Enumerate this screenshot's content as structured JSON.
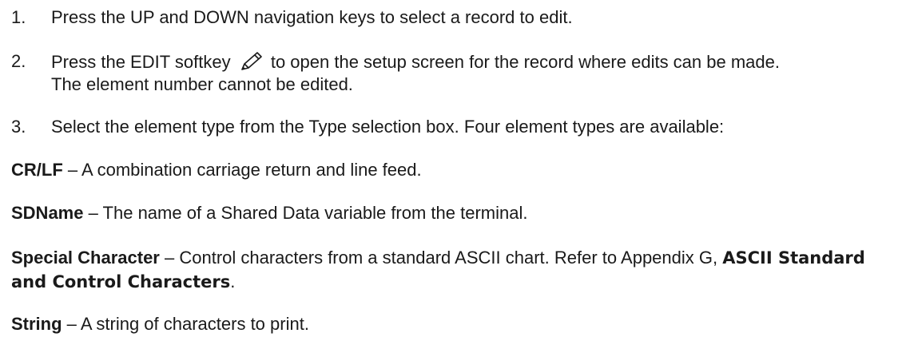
{
  "steps": [
    {
      "number": "1.",
      "text": "Press the UP and DOWN navigation keys to select a record to edit."
    },
    {
      "number": "2.",
      "text_before_icon": "Press the EDIT softkey",
      "icon": "pencil-icon",
      "text_after_icon": " to open the setup screen for the record where edits can be made.",
      "text_line2": "The element number cannot be edited."
    },
    {
      "number": "3.",
      "text": "Select the element type from the Type selection box. Four element types are available:"
    }
  ],
  "definitions": [
    {
      "term": "CR/LF",
      "separator": " – ",
      "description": "A combination carriage return and line feed."
    },
    {
      "term": "SDName",
      "separator": " – ",
      "description": "The name of a Shared Data variable from the terminal."
    },
    {
      "term": "Special Character",
      "separator": " – ",
      "description": "Control characters from a standard ASCII chart. Refer to Appendix G, ",
      "reference": "ASCII Standard and Control Characters",
      "trailing": "."
    },
    {
      "term": "String",
      "separator": " – ",
      "description": "A string of characters to print."
    }
  ]
}
